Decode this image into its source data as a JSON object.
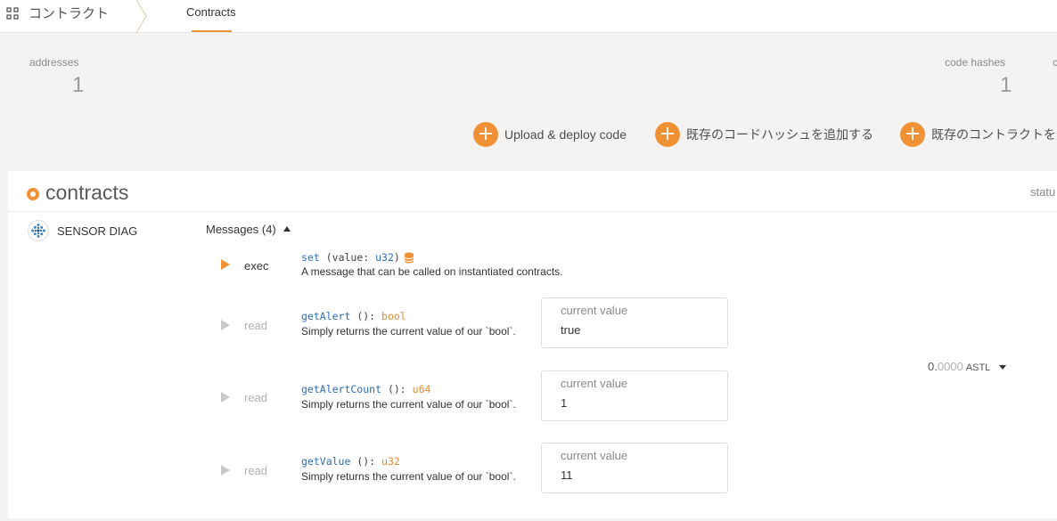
{
  "topbar": {
    "app_title": "コントラクト",
    "tab_label": "Contracts"
  },
  "summary": {
    "addresses_label": "addresses",
    "addresses_value": "1",
    "code_hashes_label": "code hashes",
    "code_hashes_value": "1",
    "third_label_fragment": "c"
  },
  "actions": {
    "upload_label": "Upload & deploy code",
    "add_code_hash_label": "既存のコードハッシュを追加する",
    "add_contract_label": "既存のコントラクトを追"
  },
  "contracts_card": {
    "title": "contracts",
    "status_label": "statu",
    "contract_name": "SENSOR DIAG",
    "messages_toggle": "Messages (4)",
    "messages": [
      {
        "kind": "exec",
        "name": "set",
        "params": "(value: ",
        "param_type": "u32",
        "close": ")",
        "description": "A message that can be called on instantiated contracts."
      },
      {
        "kind": "read",
        "name": "getAlert",
        "params": " (): ",
        "return_type": "bool",
        "description": "Simply returns the current value of our `bool`.",
        "value_label": "current value",
        "value": "true"
      },
      {
        "kind": "read",
        "name": "getAlertCount",
        "params": " (): ",
        "return_type": "u64",
        "description": "Simply returns the current value of our `bool`.",
        "value_label": "current value",
        "value": "1"
      },
      {
        "kind": "read",
        "name": "getValue",
        "params": " (): ",
        "return_type": "u32",
        "description": "Simply returns the current value of our `bool`.",
        "value_label": "current value",
        "value": "11"
      }
    ],
    "balance": {
      "int": "0.",
      "frac": "0000",
      "unit": "ASTL"
    }
  },
  "colors": {
    "accent": "#f19135",
    "type_color": "#e58a2c",
    "name_color": "#2f6fb5"
  },
  "icons": [
    "grid-icon",
    "plus-icon",
    "database-icon",
    "play-icon",
    "caret-up-icon",
    "caret-down-icon",
    "contract-identicon"
  ]
}
